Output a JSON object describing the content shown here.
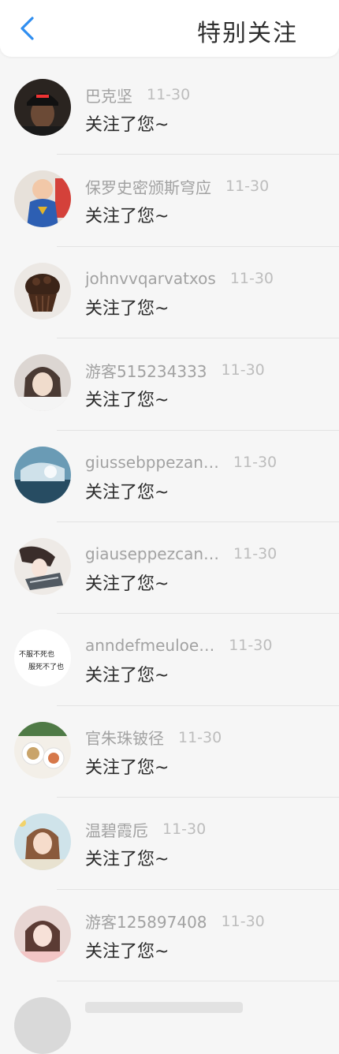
{
  "header": {
    "title": "特别关注"
  },
  "list": [
    {
      "name": "巴克坚",
      "date": "11-30",
      "action": "关注了您~",
      "avatar": "person-dark-cap"
    },
    {
      "name": "保罗史密颁斯穹应",
      "date": "11-30",
      "action": "关注了您~",
      "avatar": "child-superman"
    },
    {
      "name": "johnvvqarvatxos",
      "date": "11-30",
      "action": "关注了您~",
      "avatar": "cupcake"
    },
    {
      "name": "游客515234333",
      "date": "11-30",
      "action": "关注了您~",
      "avatar": "girl-portrait"
    },
    {
      "name": "giussebppezan…",
      "date": "11-30",
      "action": "关注了您~",
      "avatar": "blue-landscape"
    },
    {
      "name": "giauseppezcan…",
      "date": "11-30",
      "action": "关注了您~",
      "avatar": "anime-sketch"
    },
    {
      "name": "anndefmeuloe…",
      "date": "11-30",
      "action": "关注了您~",
      "avatar": "text-image",
      "avatar_text_1": "不服不死也",
      "avatar_text_2": "服死不了也"
    },
    {
      "name": "官朱珠铍径",
      "date": "11-30",
      "action": "关注了您~",
      "avatar": "food-dishes"
    },
    {
      "name": "温碧霞卮",
      "date": "11-30",
      "action": "关注了您~",
      "avatar": "girl-flowers"
    },
    {
      "name": "游客125897408",
      "date": "11-30",
      "action": "关注了您~",
      "avatar": "girl-pink"
    }
  ],
  "colors": {
    "accent": "#2f8ef0",
    "background": "#f6f6f6",
    "name_text": "#a2a2a2",
    "date_text": "#bdbdbd",
    "action_text": "#2c2c2c"
  }
}
